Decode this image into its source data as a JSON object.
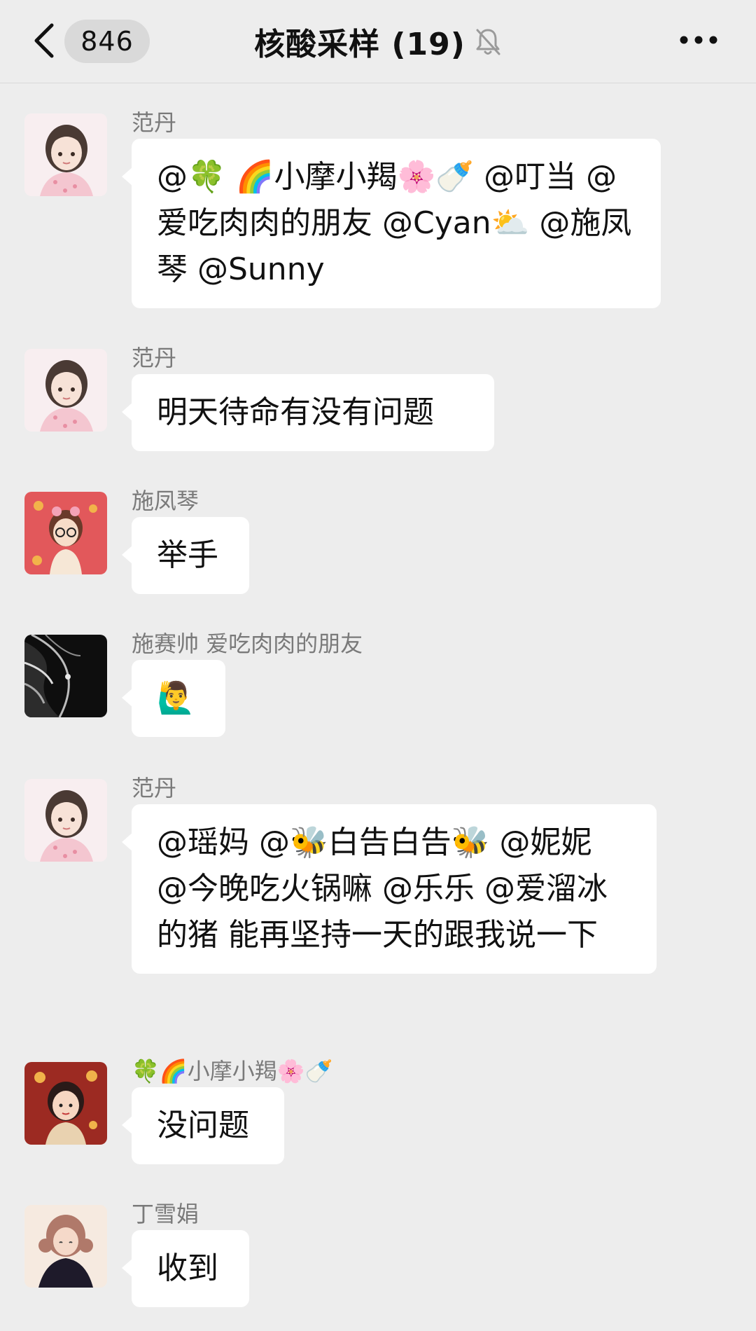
{
  "header": {
    "unread_count": "846",
    "title": "核酸采样 (19)"
  },
  "messages": [
    {
      "sender": "范丹",
      "text": "@🍀 🌈小摩小羯🌸🍼 @叮当 @爱吃肉肉的朋友 @Cyan⛅ @施凤琴 @Sunny"
    },
    {
      "sender": "范丹",
      "text": "明天待命有没有问题"
    },
    {
      "sender": "施凤琴",
      "text": "举手"
    },
    {
      "sender": "施赛帅 爱吃肉肉的朋友",
      "text": "🙋‍♂️"
    },
    {
      "sender": "范丹",
      "text": "@瑶妈 @🐝白告白告🐝 @妮妮 @今晚吃火锅嘛 @乐乐 @爱溜冰的猪 能再坚持一天的跟我说一下"
    },
    {
      "sender": "🍀🌈小摩小羯🌸🍼",
      "text": "没问题"
    },
    {
      "sender": "丁雪娟",
      "text": "收到"
    }
  ],
  "colors": {
    "background": "#ededed",
    "bubble": "#ffffff",
    "sender_name": "#7a7a7a",
    "badge": "#d9d9d9"
  },
  "icons": {
    "back": "chevron-left-icon",
    "mute": "bell-muted-icon",
    "more": "ellipsis-icon"
  }
}
